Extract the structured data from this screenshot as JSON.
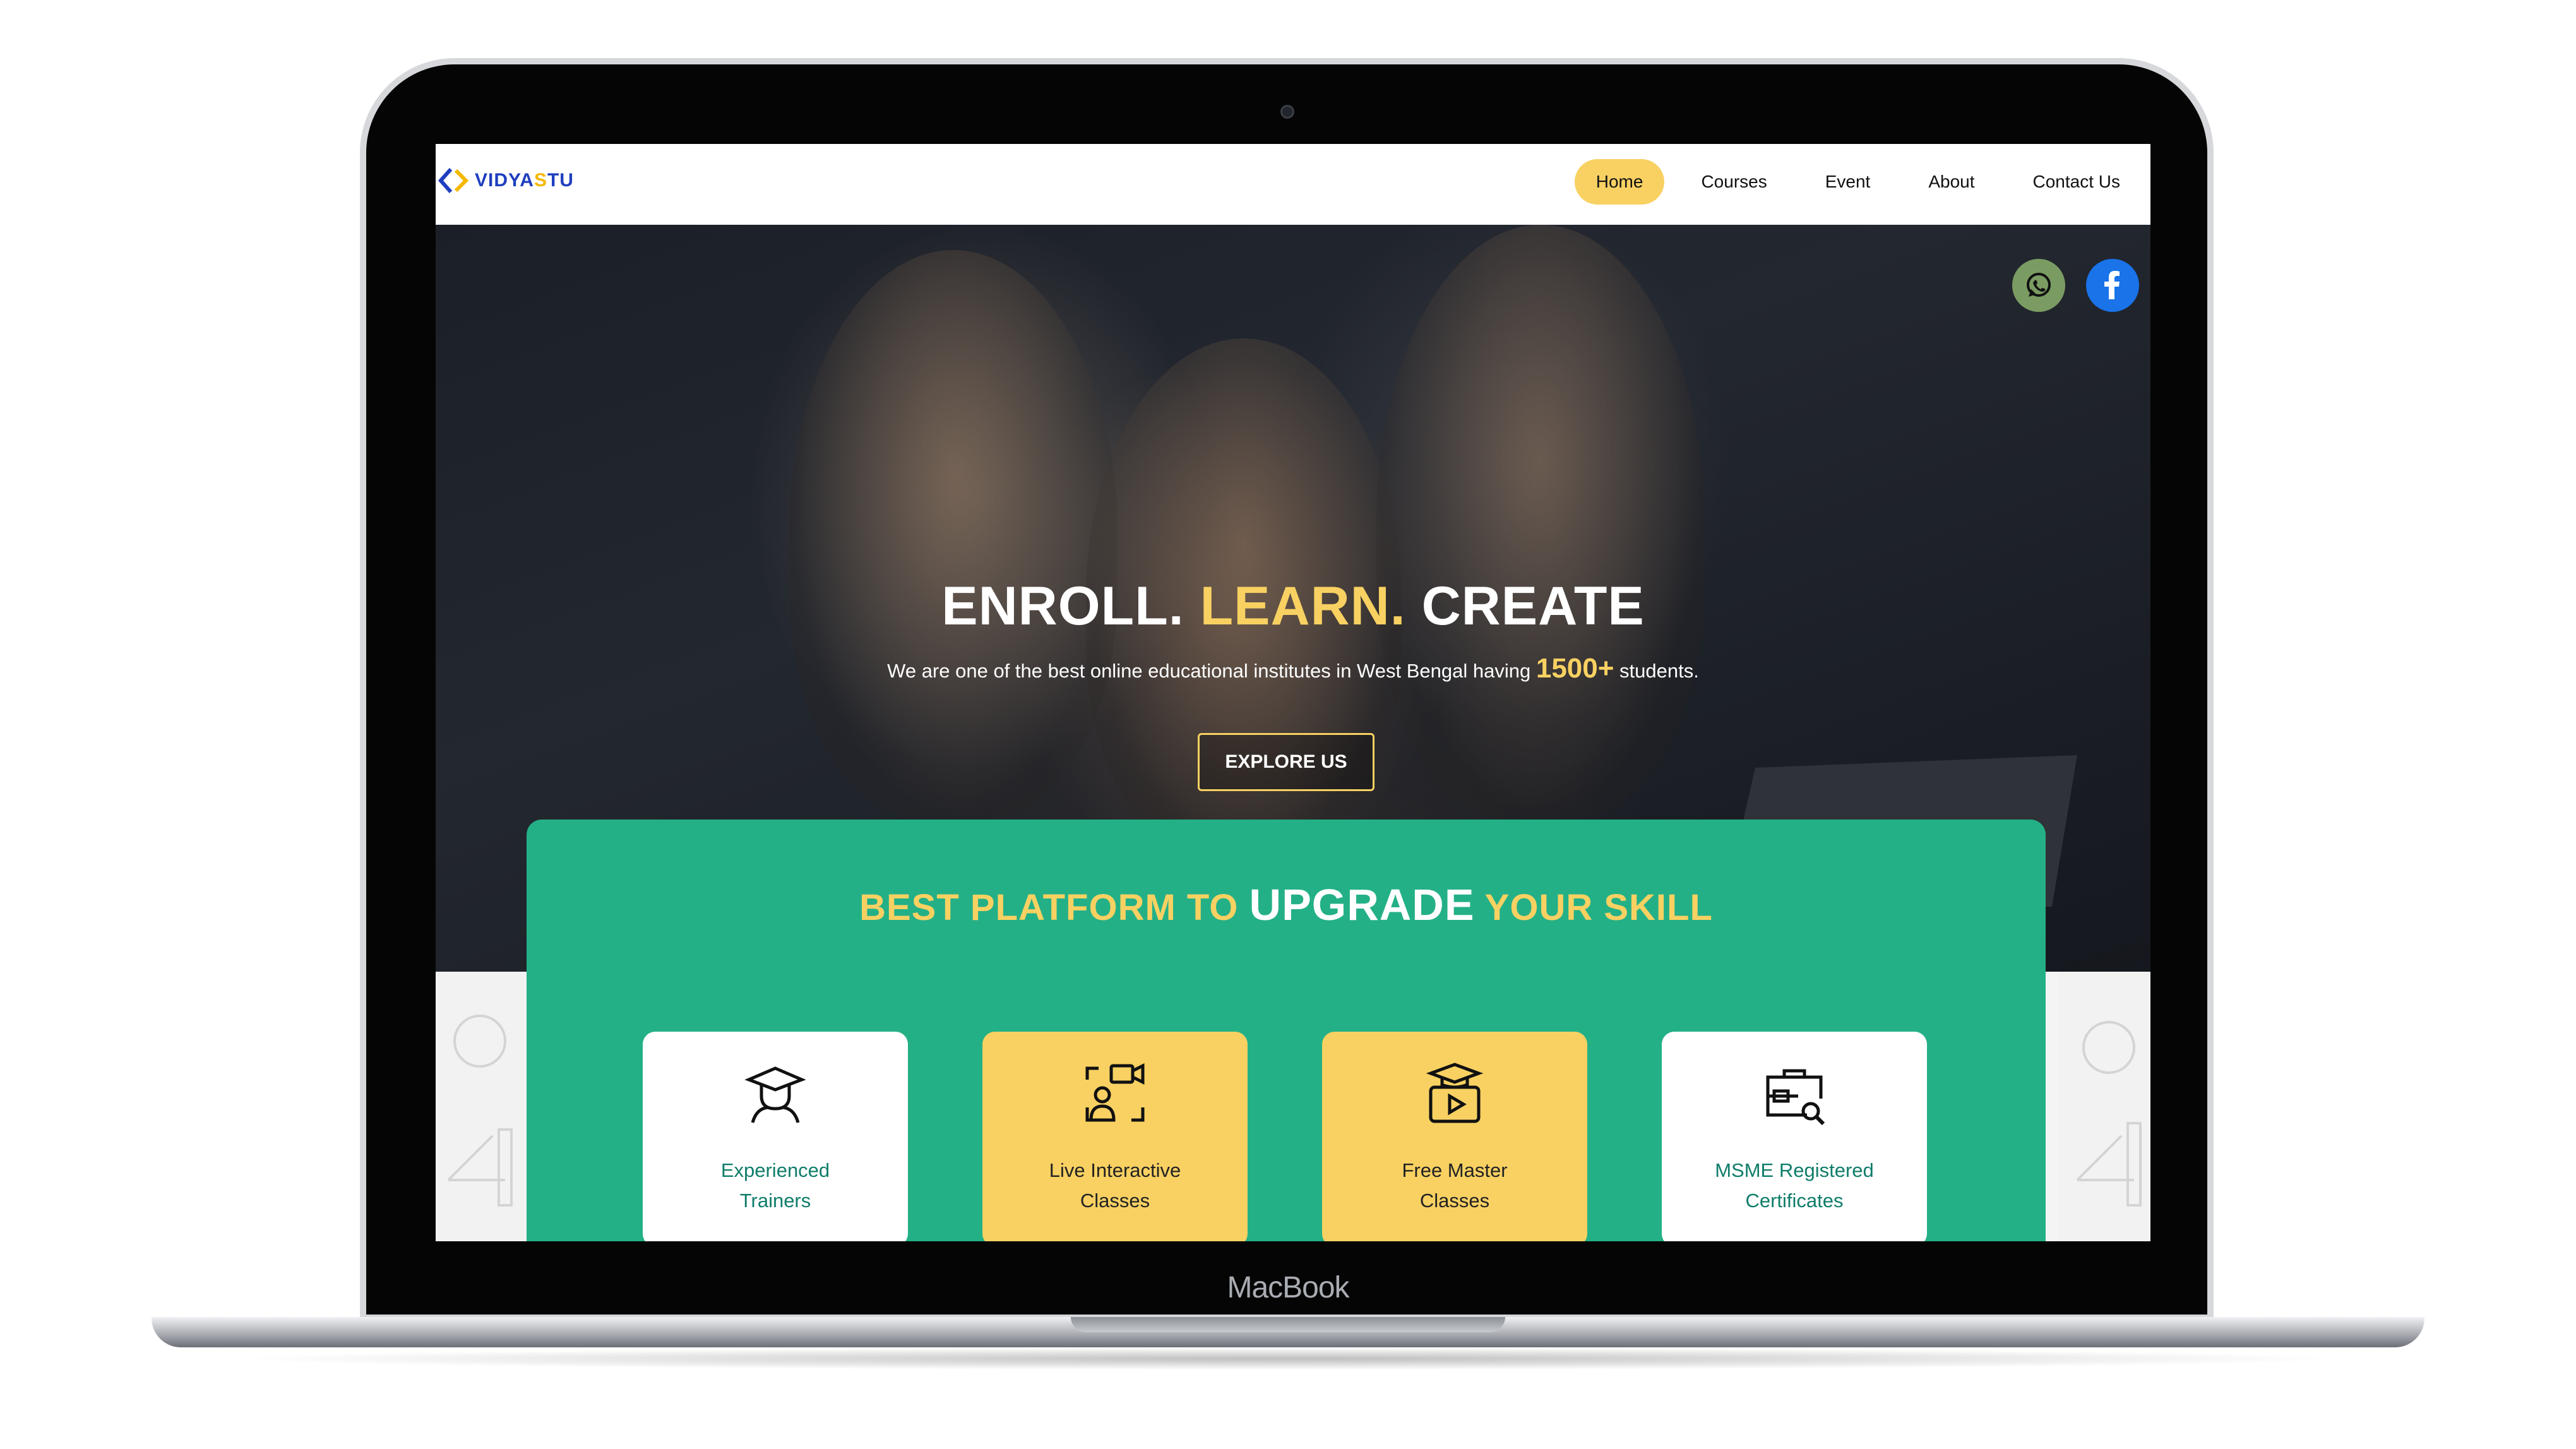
{
  "device": {
    "label": "MacBook"
  },
  "brand": {
    "logo_main": "VIDYA",
    "logo_accent": "S",
    "logo_end": "TU"
  },
  "nav": {
    "items": [
      {
        "label": "Home",
        "active": true
      },
      {
        "label": "Courses",
        "active": false
      },
      {
        "label": "Event",
        "active": false
      },
      {
        "label": "About",
        "active": false
      },
      {
        "label": "Contact Us",
        "active": false
      }
    ]
  },
  "social": [
    {
      "name": "whatsapp-icon",
      "color": "#7a9c63"
    },
    {
      "name": "facebook-icon",
      "color": "#1a73e8"
    }
  ],
  "hero": {
    "title_part1": "ENROLL.",
    "title_part2": "LEARN.",
    "title_part3": "CREATE",
    "subtitle_before": "We are one of the best online educational institutes in West Bengal having",
    "subtitle_count": "1500+",
    "subtitle_after": "students.",
    "cta_label": "EXPLORE US"
  },
  "features": {
    "heading_before": "BEST PLATFORM TO",
    "heading_emphasis": "UPGRADE",
    "heading_after": "YOUR SKILL",
    "cards": [
      {
        "label": "Experienced\nTrainers",
        "icon": "teacher-icon",
        "style": "white"
      },
      {
        "label": "Live Interactive\nClasses",
        "icon": "video-call-icon",
        "style": "yellow"
      },
      {
        "label": "Free Master\nClasses",
        "icon": "graduation-video-icon",
        "style": "yellow"
      },
      {
        "label": "MSME Registered\nCertificates",
        "icon": "certificate-search-icon",
        "style": "white"
      }
    ]
  },
  "colors": {
    "accent_yellow": "#f8d162",
    "panel_green": "#24b087",
    "brand_blue": "#1f3fbf",
    "card_text_green": "#0f7d6a"
  }
}
